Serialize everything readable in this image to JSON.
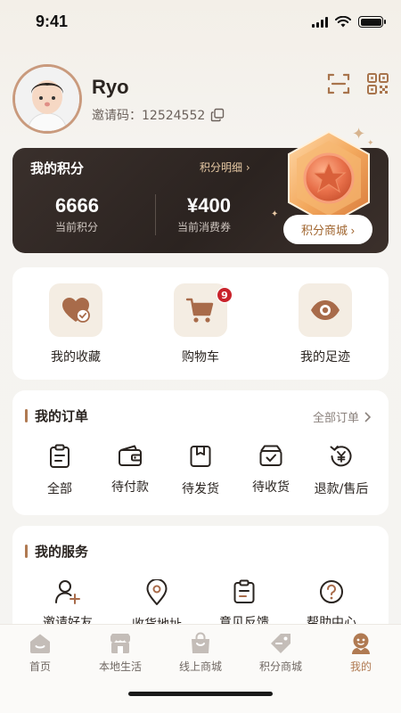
{
  "status_bar": {
    "time": "9:41"
  },
  "profile": {
    "name": "Ryo",
    "invite_label": "邀请码：",
    "invite_code": "12524552"
  },
  "points": {
    "title": "我的积分",
    "detail_link": "积分明细 ›",
    "current_points": "6666",
    "current_points_label": "当前积分",
    "voucher": "¥400",
    "voucher_label": "当前消费券",
    "mall_button": "积分商城 ›"
  },
  "quick_actions": [
    {
      "label": "我的收藏",
      "icon": "heart-check-icon"
    },
    {
      "label": "购物车",
      "icon": "cart-icon",
      "badge": "9"
    },
    {
      "label": "我的足迹",
      "icon": "eye-icon"
    }
  ],
  "orders": {
    "title": "我的订单",
    "all_link": "全部订单",
    "items": [
      {
        "label": "全部",
        "icon": "clipboard-icon"
      },
      {
        "label": "待付款",
        "icon": "wallet-icon"
      },
      {
        "label": "待发货",
        "icon": "box-icon"
      },
      {
        "label": "待收货",
        "icon": "package-check-icon"
      },
      {
        "label": "退款/售后",
        "icon": "refund-icon"
      }
    ]
  },
  "services": {
    "title": "我的服务",
    "items": [
      {
        "label": "邀请好友",
        "icon": "user-add-icon"
      },
      {
        "label": "收货地址",
        "icon": "location-pin-icon"
      },
      {
        "label": "意见反馈",
        "icon": "feedback-icon"
      },
      {
        "label": "帮助中心",
        "icon": "help-icon"
      }
    ]
  },
  "tabbar": {
    "active": "我的",
    "accent_color": "#b07a52",
    "items": [
      {
        "label": "首页",
        "icon": "home-icon"
      },
      {
        "label": "本地生活",
        "icon": "store-icon"
      },
      {
        "label": "线上商城",
        "icon": "bag-icon"
      },
      {
        "label": "积分商城",
        "icon": "tag-icon"
      },
      {
        "label": "我的",
        "icon": "profile-icon"
      }
    ]
  }
}
